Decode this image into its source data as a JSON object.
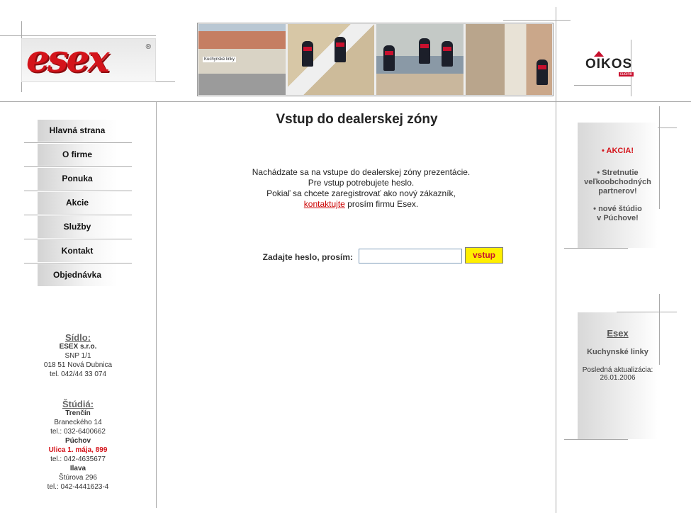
{
  "header": {
    "logo_text": "esex",
    "logo_mark": "®",
    "photo_sign": "Kuchynské linky",
    "partner_logo": "OIKOS",
    "partner_sub": "cucine"
  },
  "menu": [
    "Hlavná strana",
    "O firme",
    "Ponuka",
    "Akcie",
    "Služby",
    "Kontakt",
    "Objednávka"
  ],
  "sidlo": {
    "title": "Sídlo:",
    "company": "ESEX s.r.o.",
    "street": "SNP 1/1",
    "city": "018 51 Nová Dubnica",
    "phone": "tel. 042/44 33 074"
  },
  "studia": {
    "title": "Štúdiá:",
    "trencin": {
      "name": "Trenčín",
      "street": "Braneckého 14",
      "phone": "tel.: 032-6400662"
    },
    "puchov": {
      "name": "Púchov",
      "street": "Ulica 1. mája, 899",
      "phone": "tel.: 042-4635677"
    },
    "ilava": {
      "name": "Ilava",
      "street": "Štúrova 296",
      "phone": "tel.: 042-4441623-4"
    }
  },
  "main": {
    "title": "Vstup do dealerskej zóny",
    "line1": "Nachádzate sa na vstupe do dealerskej zóny prezentácie.",
    "line2": "Pre vstup potrebujete heslo.",
    "line3": "Pokiaľ sa chcete zaregistrovať ako nový zákazník,",
    "link": "kontaktujte",
    "line4_rest": " prosím firmu Esex.",
    "pw_label": "Zadajte heslo, prosím:",
    "pw_value": "",
    "submit": "vstup"
  },
  "news": {
    "item1": "• AKCIA!",
    "item2a": "• Stretnutie",
    "item2b": "veľkoobchodných",
    "item2c": "partnerov!",
    "item3a": "• nové štúdio",
    "item3b": "v Púchove!"
  },
  "info": {
    "title": "Esex",
    "subtitle": "Kuchynské linky",
    "updated_label": "Posledná aktualizácia:",
    "updated_date": "26.01.2006"
  },
  "colors": {
    "brand_red": "#d4141b",
    "button_yellow": "#ffef00",
    "lines": "#a9a9a9"
  }
}
